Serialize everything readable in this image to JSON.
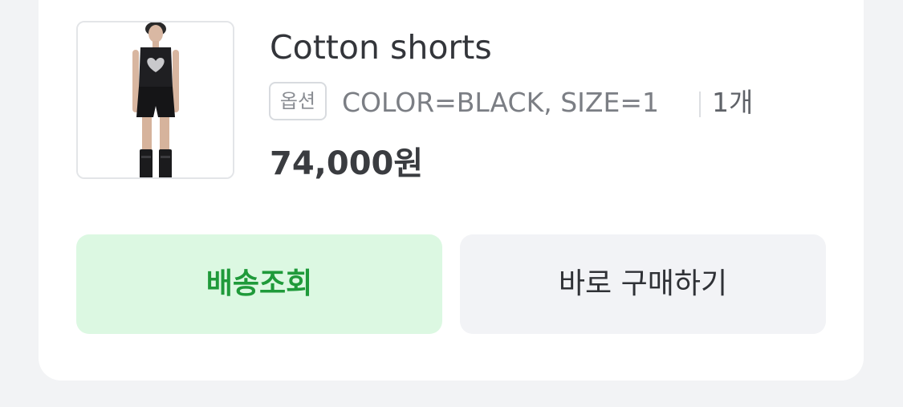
{
  "product": {
    "image_alt": "model wearing black top and shorts",
    "name": "Cotton shorts",
    "option_badge": "옵션",
    "option_text": "COLOR=BLACK, SIZE=1",
    "quantity": "1개",
    "price": "74,000원"
  },
  "actions": {
    "track_label": "배송조회",
    "buy_label": "바로 구매하기"
  },
  "colors": {
    "track_bg": "#dcf8e2",
    "track_text": "#1f9a3a",
    "buy_bg": "#f2f3f6"
  }
}
